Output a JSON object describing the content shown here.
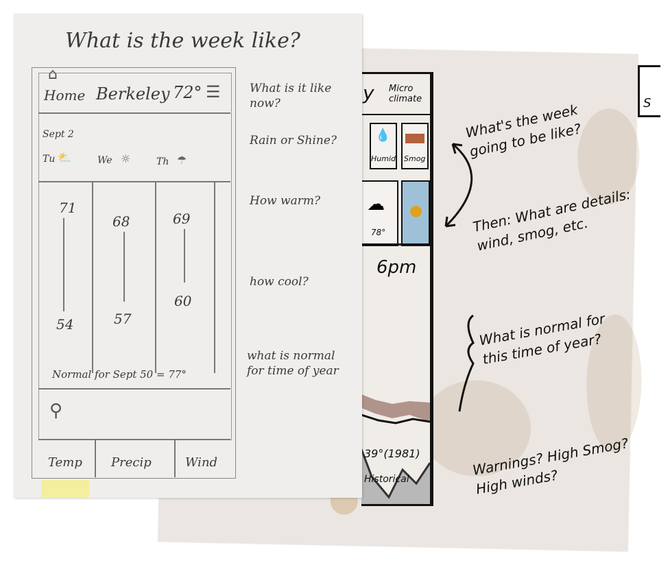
{
  "front_sheet": {
    "title": "What is the week like?",
    "header": {
      "home": "Home",
      "city": "Berkeley",
      "temp": "72°"
    },
    "date": "Sept 2",
    "days": [
      {
        "label": "Tu",
        "high": "71",
        "low": "54"
      },
      {
        "label": "We",
        "high": "68",
        "low": "57"
      },
      {
        "label": "Th",
        "high": "69",
        "low": "60"
      }
    ],
    "normal_text": "Normal for Sept 50 = 77°",
    "tabs": [
      "Temp",
      "Precip",
      "Wind"
    ],
    "annotations": [
      "What is it like now?",
      "Rain or Shine?",
      "How warm?",
      "how cool?",
      "what is normal for time of year"
    ]
  },
  "back_sheet": {
    "header_fragment": "y",
    "micro_climate": "Micro climate",
    "tile_labels": [
      "Humid",
      "Smog"
    ],
    "temp_label": "78°",
    "time_label": "6pm",
    "record_label": "39°(1981)",
    "bottom_label": "Historical",
    "annotations": [
      "What's the week going to be like?",
      "Then: What are details: wind, smog, etc.",
      "What is normal for this time of year?",
      "Warnings? High Smog? High winds?"
    ]
  }
}
